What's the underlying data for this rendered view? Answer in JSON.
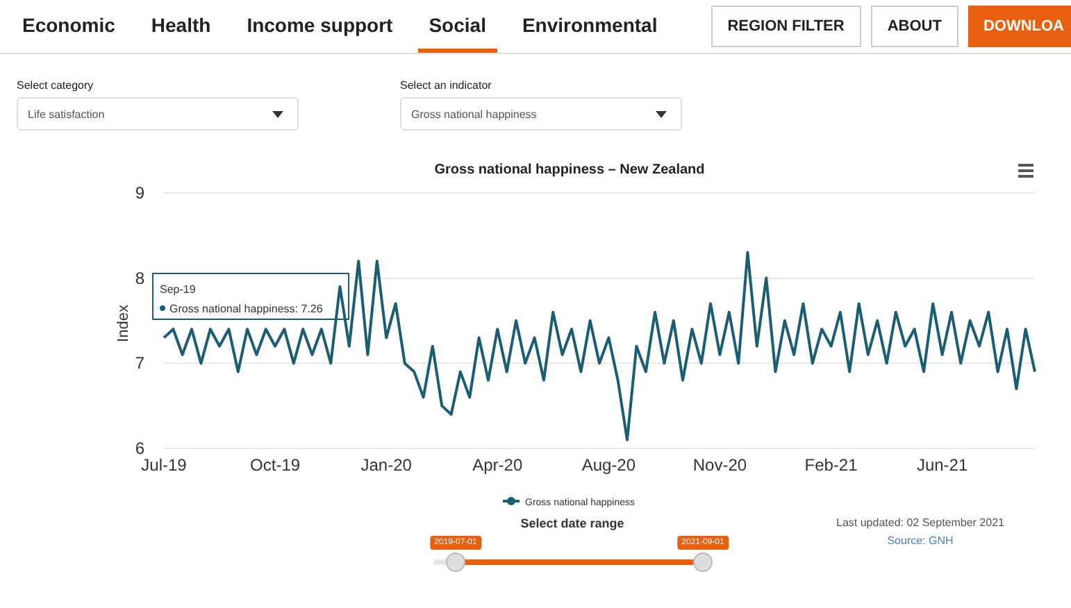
{
  "nav": {
    "tabs": [
      {
        "label": "Economic",
        "selected": false
      },
      {
        "label": "Health",
        "selected": false
      },
      {
        "label": "Income support",
        "selected": false
      },
      {
        "label": "Social",
        "selected": true
      },
      {
        "label": "Environmental",
        "selected": false
      }
    ],
    "buttons": [
      {
        "label": "REGION FILTER",
        "kind": "outline"
      },
      {
        "label": "ABOUT",
        "kind": "outline"
      },
      {
        "label": "DOWNLOA",
        "kind": "filled"
      }
    ]
  },
  "filters": [
    {
      "label": "Select category",
      "value": "Life satisfaction"
    },
    {
      "label": "Select an indicator",
      "value": "Gross national happiness"
    }
  ],
  "chart": {
    "chart_data": {
      "type": "line",
      "title": "Gross national happiness – New Zealand",
      "ylabel": "Index",
      "categories": [
        "Jul-19",
        null,
        null,
        null,
        null,
        null,
        null,
        null,
        null,
        null,
        null,
        null,
        "Oct-19",
        null,
        null,
        null,
        null,
        null,
        null,
        null,
        null,
        null,
        null,
        null,
        "Jan-20",
        null,
        null,
        null,
        null,
        null,
        null,
        null,
        null,
        null,
        null,
        null,
        "Apr-20",
        null,
        null,
        null,
        null,
        null,
        null,
        null,
        null,
        null,
        null,
        null,
        "Aug-20",
        null,
        null,
        null,
        null,
        null,
        null,
        null,
        null,
        null,
        null,
        null,
        "Nov-20",
        null,
        null,
        null,
        null,
        null,
        null,
        null,
        null,
        null,
        null,
        null,
        "Feb-21",
        null,
        null,
        null,
        null,
        null,
        null,
        null,
        null,
        null,
        null,
        null,
        "Jun-21",
        null,
        null,
        null,
        null,
        null,
        null,
        null,
        null,
        null,
        null
      ],
      "ylim": [
        6,
        9
      ],
      "yticks": [
        6,
        7,
        8,
        9
      ],
      "series": [
        {
          "name": "Gross national happiness",
          "color": "#1b5e73",
          "values": [
            7.3,
            7.4,
            7.1,
            7.4,
            7.0,
            7.4,
            7.2,
            7.4,
            6.9,
            7.4,
            7.1,
            7.4,
            7.2,
            7.4,
            7.0,
            7.4,
            7.1,
            7.4,
            7.0,
            7.9,
            7.2,
            8.2,
            7.1,
            8.2,
            7.3,
            7.7,
            7.0,
            6.9,
            6.6,
            7.2,
            6.5,
            6.4,
            6.9,
            6.6,
            7.3,
            6.8,
            7.4,
            6.9,
            7.5,
            7.0,
            7.3,
            6.8,
            7.6,
            7.1,
            7.4,
            6.9,
            7.5,
            7.0,
            7.3,
            6.8,
            6.1,
            7.2,
            6.9,
            7.6,
            7.0,
            7.5,
            6.8,
            7.4,
            7.0,
            7.7,
            7.1,
            7.6,
            7.0,
            8.3,
            7.2,
            8.0,
            6.9,
            7.5,
            7.1,
            7.7,
            7.0,
            7.4,
            7.2,
            7.6,
            6.9,
            7.7,
            7.1,
            7.5,
            7.0,
            7.6,
            7.2,
            7.4,
            6.9,
            7.7,
            7.1,
            7.6,
            7.0,
            7.5,
            7.2,
            7.6,
            6.9,
            7.4,
            6.7,
            7.4,
            6.9
          ]
        }
      ]
    },
    "tooltip": {
      "title": "Sep-19",
      "text": "Gross national happiness: 7.26"
    }
  },
  "date_range": {
    "label": "Select date range",
    "handles": [
      {
        "value_label": "2019-07-01",
        "level": 0.08
      },
      {
        "value_label": "2021-09-01",
        "level": 0.97
      }
    ]
  },
  "footer": {
    "updated": "Last updated: 02 September 2021",
    "source": "Source: GNH"
  }
}
